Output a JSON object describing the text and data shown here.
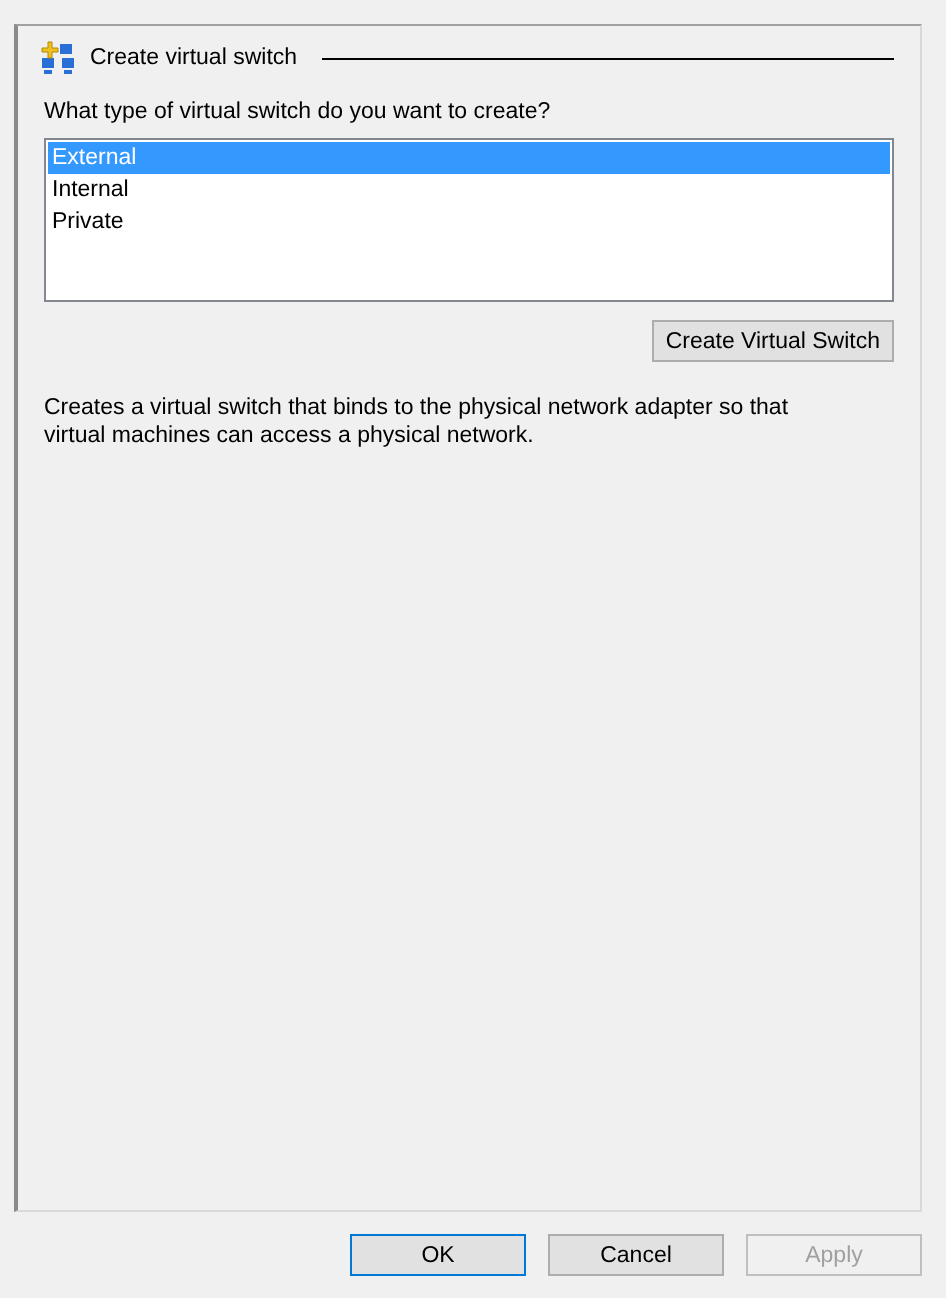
{
  "section": {
    "title": "Create virtual switch"
  },
  "question": "What type of virtual switch do you want to create?",
  "switch_types": [
    {
      "label": "External",
      "selected": true
    },
    {
      "label": "Internal",
      "selected": false
    },
    {
      "label": "Private",
      "selected": false
    }
  ],
  "create_button": "Create Virtual Switch",
  "description": "Creates a virtual switch that binds to the physical network adapter so that virtual machines can access a physical network.",
  "buttons": [
    {
      "label": "OK",
      "kind": "default",
      "disabled": false
    },
    {
      "label": "Cancel",
      "kind": "normal",
      "disabled": false
    },
    {
      "label": "Apply",
      "kind": "normal",
      "disabled": true
    }
  ]
}
